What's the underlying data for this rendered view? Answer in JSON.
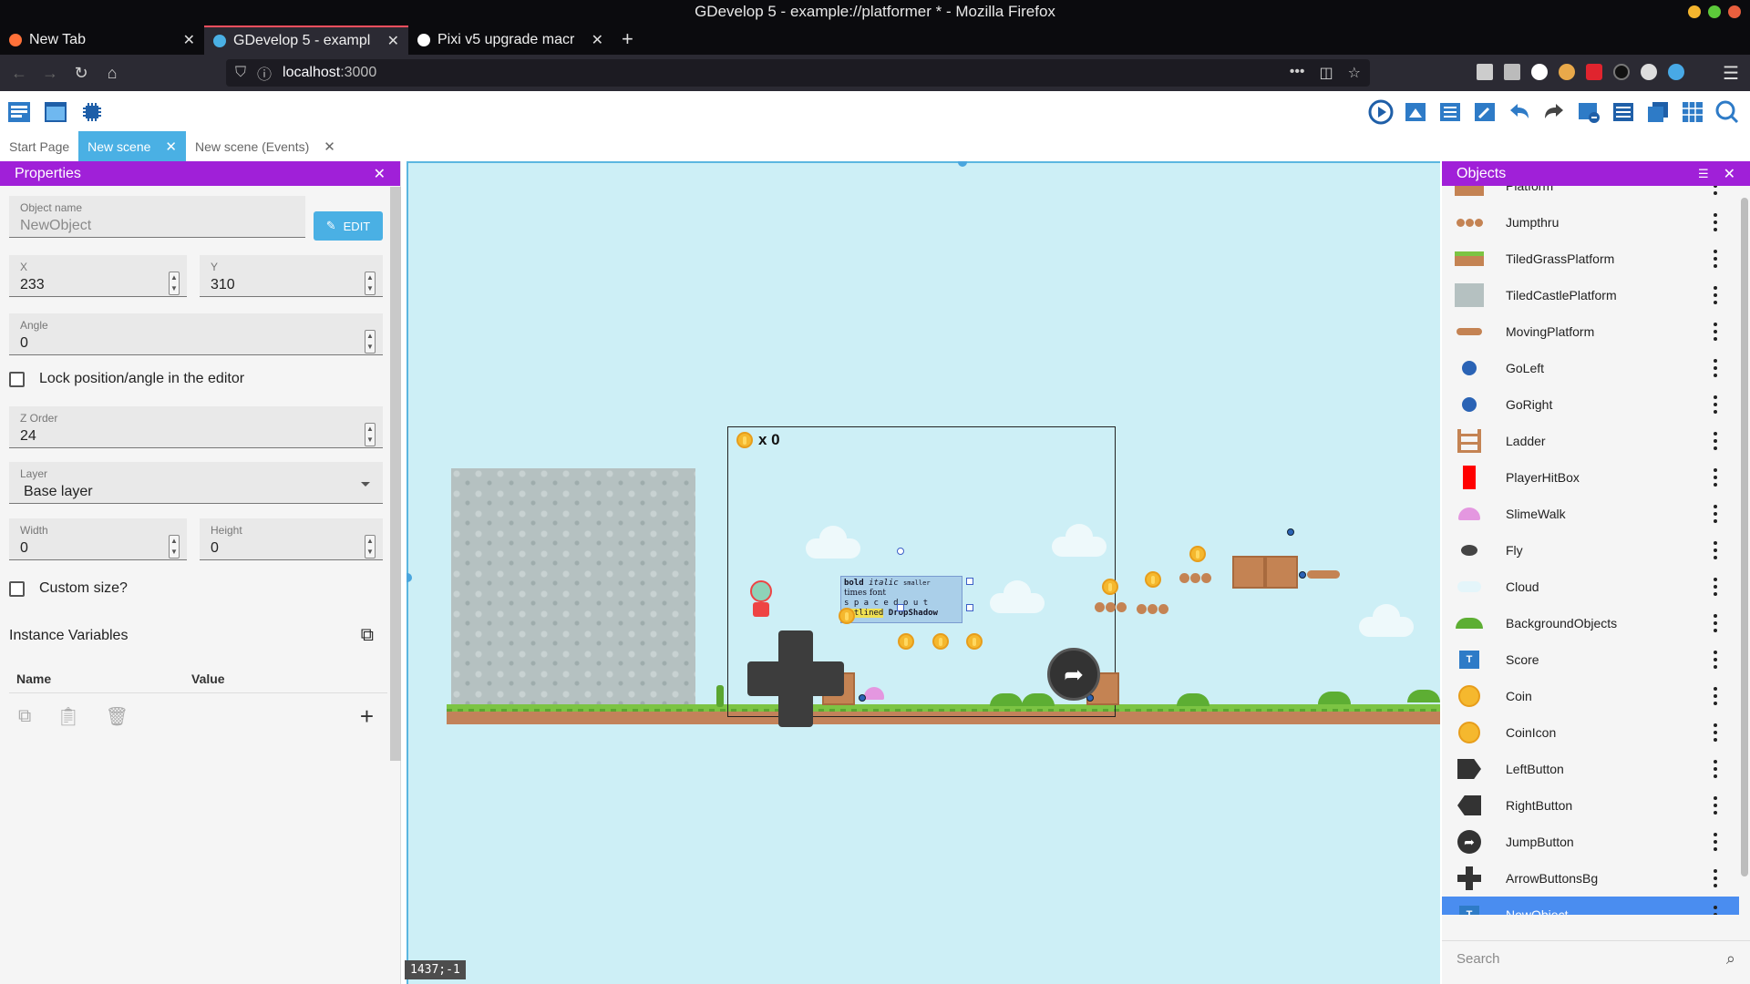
{
  "window": {
    "title": "GDevelop 5 - example://platformer * - Mozilla Firefox"
  },
  "browser_tabs": [
    {
      "title": "New Tab",
      "active": false
    },
    {
      "title": "GDevelop 5 - exampl",
      "active": true
    },
    {
      "title": "Pixi v5 upgrade macr",
      "active": false
    }
  ],
  "url": {
    "host": "localhost",
    "port": ":3000"
  },
  "scene_tabs": [
    {
      "label": "Start Page",
      "active": false,
      "closable": false
    },
    {
      "label": "New scene",
      "active": true,
      "closable": true
    },
    {
      "label": "New scene (Events)",
      "active": false,
      "closable": true
    }
  ],
  "properties": {
    "title": "Properties",
    "object_name_label": "Object name",
    "object_name_value": "NewObject",
    "edit_label": "EDIT",
    "x_label": "X",
    "x_value": "233",
    "y_label": "Y",
    "y_value": "310",
    "angle_label": "Angle",
    "angle_value": "0",
    "lock_label": "Lock position/angle in the editor",
    "zorder_label": "Z Order",
    "zorder_value": "24",
    "layer_label": "Layer",
    "layer_value": "Base layer",
    "width_label": "Width",
    "width_value": "0",
    "height_label": "Height",
    "height_value": "0",
    "custom_size_label": "Custom size?",
    "instance_variables_label": "Instance Variables",
    "col_name": "Name",
    "col_value": "Value"
  },
  "scene": {
    "score_text": "x 0",
    "text_object": {
      "line1_bold": "bold",
      "line1_italic": "italic",
      "line1_small": "smaller",
      "line2": "times font",
      "line3": "s p a c e d   o u t",
      "line4_outlined": "outlined",
      "line4_shadow": "DropShadow"
    },
    "cursor_coords": "1437;-1"
  },
  "objects": {
    "title": "Objects",
    "items": [
      {
        "name": "Platform",
        "icon": "platform-icon"
      },
      {
        "name": "Jumpthru",
        "icon": "jumpthru-icon"
      },
      {
        "name": "TiledGrassPlatform",
        "icon": "grass-platform-icon"
      },
      {
        "name": "TiledCastlePlatform",
        "icon": "castle-platform-icon"
      },
      {
        "name": "MovingPlatform",
        "icon": "moving-platform-icon"
      },
      {
        "name": "GoLeft",
        "icon": "goleft-icon"
      },
      {
        "name": "GoRight",
        "icon": "goright-icon"
      },
      {
        "name": "Ladder",
        "icon": "ladder-icon"
      },
      {
        "name": "PlayerHitBox",
        "icon": "hitbox-icon"
      },
      {
        "name": "SlimeWalk",
        "icon": "slime-icon"
      },
      {
        "name": "Fly",
        "icon": "fly-icon"
      },
      {
        "name": "Cloud",
        "icon": "cloud-icon"
      },
      {
        "name": "BackgroundObjects",
        "icon": "background-icon"
      },
      {
        "name": "Score",
        "icon": "text-icon"
      },
      {
        "name": "Coin",
        "icon": "coin-icon"
      },
      {
        "name": "CoinIcon",
        "icon": "coin-icon"
      },
      {
        "name": "LeftButton",
        "icon": "left-button-icon"
      },
      {
        "name": "RightButton",
        "icon": "right-button-icon"
      },
      {
        "name": "JumpButton",
        "icon": "jump-button-icon"
      },
      {
        "name": "ArrowButtonsBg",
        "icon": "dpad-icon"
      },
      {
        "name": "NewObject",
        "icon": "text-icon",
        "selected": true
      }
    ],
    "search_placeholder": "Search"
  },
  "colors": {
    "panel_header": "#a020d8",
    "accent_blue": "#4ab0e4",
    "selection_blue": "#4a8df0",
    "scene_bg": "#cdeff6"
  }
}
